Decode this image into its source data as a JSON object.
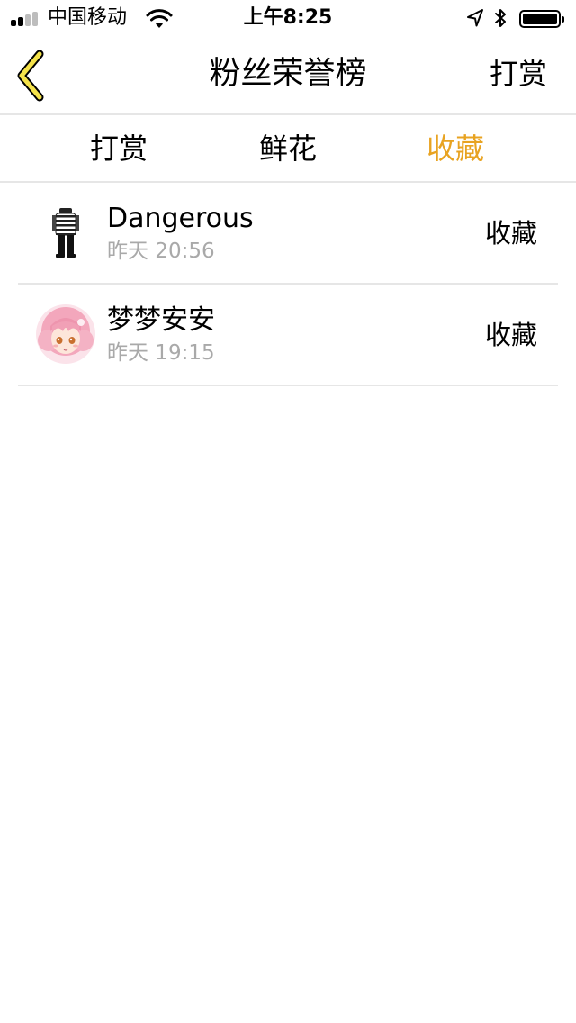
{
  "status_bar": {
    "carrier": "中国移动",
    "time": "上午8:25",
    "icons": [
      "signal-icon",
      "wifi-icon",
      "location-icon",
      "bluetooth-icon",
      "battery-icon"
    ]
  },
  "nav": {
    "title": "粉丝荣誉榜",
    "action_label": "打赏",
    "back_icon": "chevron-left-icon",
    "back_icon_color": "#f5e34a"
  },
  "tabs": [
    {
      "label": "打赏",
      "active": false
    },
    {
      "label": "鲜花",
      "active": false
    },
    {
      "label": "收藏",
      "active": true
    }
  ],
  "colors": {
    "accent": "#e8a321",
    "secondary_text": "#a9a9a9",
    "divider": "#e6e6e6"
  },
  "list": [
    {
      "name": "Dangerous",
      "time": "昨天 20:56",
      "action": "收藏",
      "avatar": "striped-outfit-avatar"
    },
    {
      "name": "梦梦安安",
      "time": "昨天 19:15",
      "action": "收藏",
      "avatar": "anime-girl-avatar"
    }
  ]
}
